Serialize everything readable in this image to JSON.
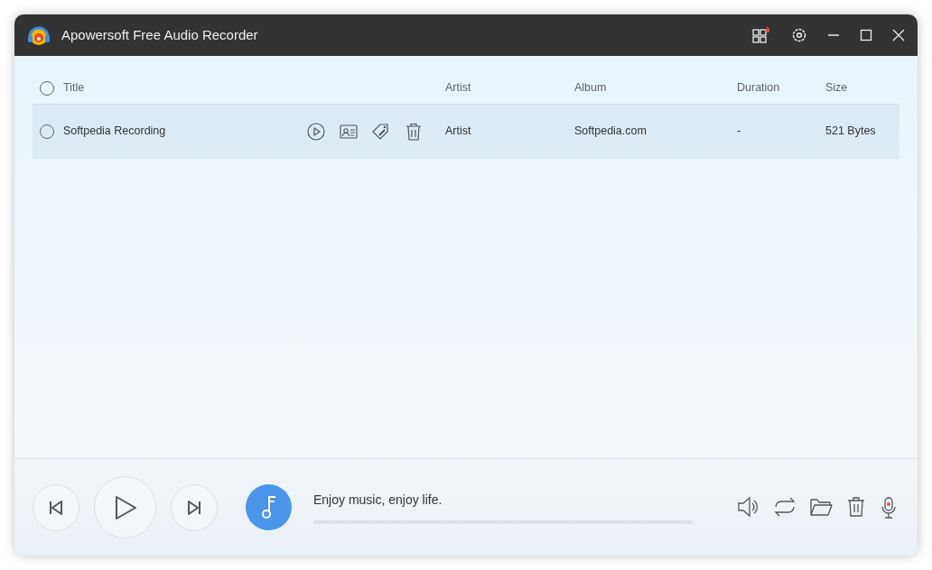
{
  "window": {
    "title": "Apowersoft Free Audio Recorder"
  },
  "table": {
    "select_all": {
      "checked": false
    },
    "columns": [
      "Title",
      "Artist",
      "Album",
      "Duration",
      "Size"
    ],
    "rows": [
      {
        "checked": false,
        "selected": true,
        "title": "Softpedia Recording",
        "artist": "Artist",
        "album": "Softpedia.com",
        "duration": "-",
        "size": "521 Bytes"
      }
    ]
  },
  "player": {
    "caption": "Enjoy music, enjoy life."
  }
}
